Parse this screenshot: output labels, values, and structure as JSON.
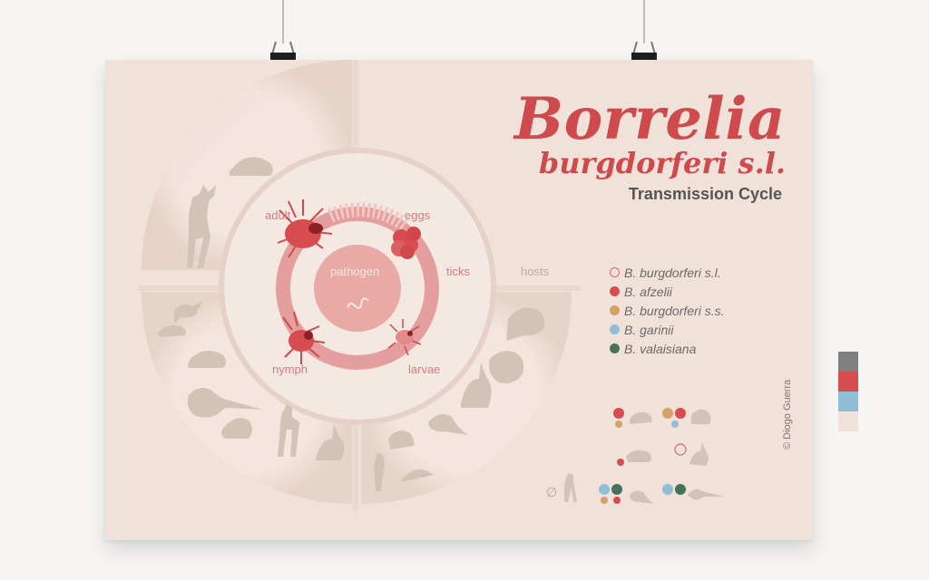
{
  "title": {
    "main": "Borrelia",
    "sub": "burgdorferi s.l.",
    "caption": "Transmission Cycle"
  },
  "cycle_labels": {
    "adult": "adult",
    "eggs": "eggs",
    "pathogen": "pathogen",
    "ticks": "ticks",
    "hosts": "hosts",
    "nymph": "nymph",
    "larvae": "larvae"
  },
  "legend": [
    {
      "label": "B. burgdorferi s.l.",
      "color": "#f1e2d9",
      "outline": "#d36a6a"
    },
    {
      "label": "B. afzelii",
      "color": "#d64c4f"
    },
    {
      "label": "B. burgdorferi s.s.",
      "color": "#d5a066"
    },
    {
      "label": "B. garinii",
      "color": "#8fbfd8"
    },
    {
      "label": "B. valaisiana",
      "color": "#46725b"
    }
  ],
  "credit": "© Diogo Guerra",
  "swatches": [
    "#808080",
    "#d64c4f",
    "#8fbfd8",
    "#f1e2d9"
  ],
  "icons": {
    "hosts": [
      "deer-icon",
      "hedgehog-icon",
      "bird-icon",
      "mouse-icon",
      "pheasant-icon",
      "squirrel-icon",
      "rabbit-icon",
      "lizard-icon"
    ],
    "ticks": [
      "tick-icon"
    ]
  },
  "colors": {
    "accent": "#cf4a4d",
    "poster_bg": "#f1e2d9",
    "silhouette": "#d3c3b6",
    "ring": "#ead3cb"
  }
}
